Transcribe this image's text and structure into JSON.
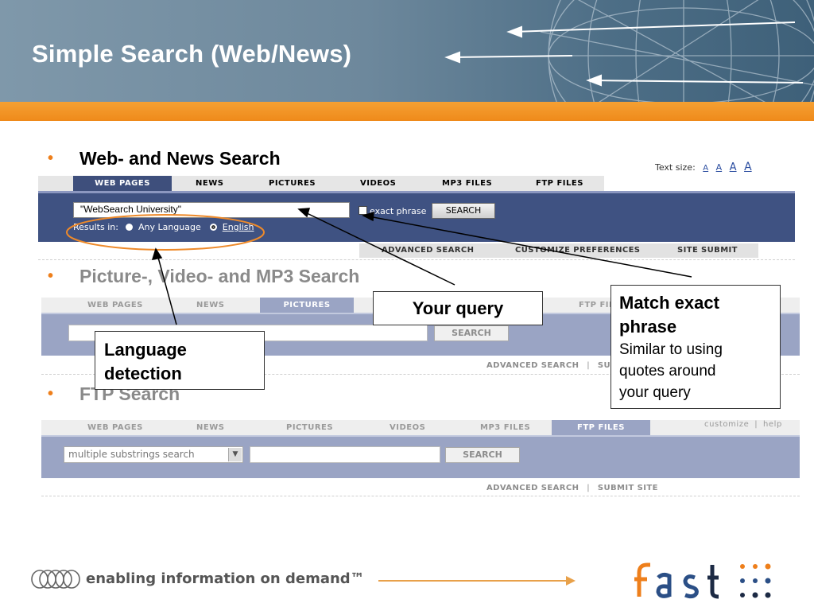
{
  "title": "Simple Search (Web/News)",
  "bullets": {
    "web": "Web- and News Search",
    "picture": "Picture-, Video- and MP3 Search",
    "ftp": "FTP Search"
  },
  "text_size": {
    "label": "Text size:",
    "options": [
      "A",
      "A",
      "A",
      "A"
    ]
  },
  "panel1": {
    "tabs": [
      "WEB PAGES",
      "NEWS",
      "PICTURES",
      "VIDEOS",
      "MP3 FILES",
      "FTP FILES"
    ],
    "active_tab": "WEB PAGES",
    "query": "\"WebSearch University\"",
    "exact_phrase_label": "exact phrase",
    "search_button": "SEARCH",
    "results_in_label": "Results in:",
    "language_options": [
      "Any Language",
      "English"
    ],
    "links": [
      "ADVANCED SEARCH",
      "CUSTOMIZE PREFERENCES",
      "SITE SUBMIT"
    ]
  },
  "panel2": {
    "tabs": [
      "WEB PAGES",
      "NEWS",
      "PICTURES",
      "FTP FIL"
    ],
    "active_tab": "PICTURES",
    "search_button": "SEARCH",
    "links": [
      "ADVANCED SEARCH",
      "|",
      "SUBM"
    ]
  },
  "panel3": {
    "tabs": [
      "WEB PAGES",
      "NEWS",
      "PICTURES",
      "VIDEOS",
      "MP3 FILES",
      "FTP FILES"
    ],
    "active_tab": "FTP FILES",
    "top_links": [
      "customize",
      "|",
      "help"
    ],
    "select_value": "multiple substrings search",
    "search_button": "SEARCH",
    "links": [
      "ADVANCED SEARCH",
      "|",
      "SUBMIT SITE"
    ]
  },
  "callouts": {
    "your_query": "Your query",
    "language_detection_1": "Language",
    "language_detection_2": "detection",
    "match_title_1": "Match exact",
    "match_title_2": "phrase",
    "match_sub_1": "Similar to using",
    "match_sub_2": "quotes around",
    "match_sub_3": "your query"
  },
  "footer": {
    "tagline": "enabling information on demand™"
  },
  "colors": {
    "tab_bar": "#e4e4e4",
    "active_tab": "#3e4f7c",
    "panel_active": "#3f5282",
    "panel_faded": "#9aa4c4",
    "accent_orange": "#ef8a1a",
    "logo_orange": "#ee7f1b",
    "logo_blue": "#2b4f86"
  }
}
